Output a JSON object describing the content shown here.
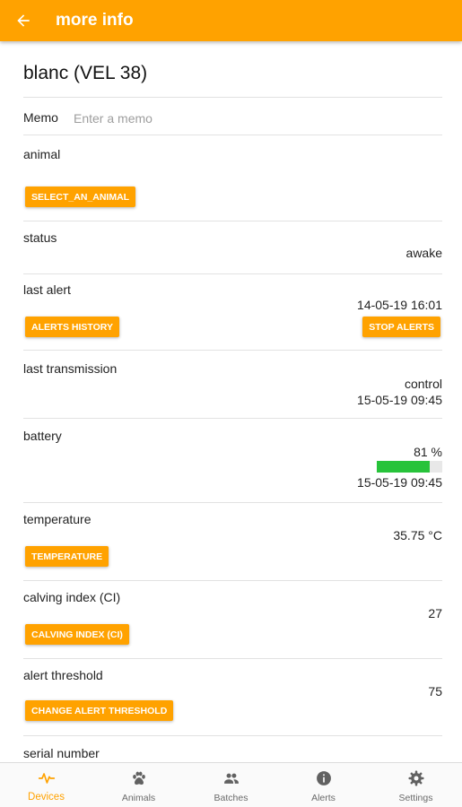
{
  "appbar": {
    "title": "more info",
    "back_icon": "arrow-left-icon"
  },
  "device": {
    "name": "blanc (VEL 38)"
  },
  "memo": {
    "label": "Memo",
    "value": "",
    "placeholder": "Enter a memo"
  },
  "animal": {
    "label": "animal",
    "button": "SELECT_AN_ANIMAL"
  },
  "status": {
    "label": "status",
    "value": "awake"
  },
  "last_alert": {
    "label": "last alert",
    "datetime": "14-05-19 16:01",
    "history_button": "ALERTS HISTORY",
    "stop_button": "STOP ALERTS"
  },
  "last_transmission": {
    "label": "last transmission",
    "type": "control",
    "datetime": "15-05-19 09:45"
  },
  "battery": {
    "label": "battery",
    "percent_text": "81 %",
    "level": 0.81,
    "datetime": "15-05-19 09:45"
  },
  "temperature": {
    "label": "temperature",
    "value": "35.75 °C",
    "button": "TEMPERATURE"
  },
  "calving_index": {
    "label": "calving index (CI)",
    "value": "27",
    "button": "CALVING INDEX (CI)"
  },
  "alert_threshold": {
    "label": "alert threshold",
    "value": "75",
    "button": "CHANGE ALERT THRESHOLD"
  },
  "serial_number": {
    "label": "serial number"
  },
  "colors": {
    "accent": "#ffa200",
    "battery": "#27c33a",
    "nav_inactive": "#616161"
  },
  "nav": {
    "devices": {
      "label": "Devices",
      "icon": "pulse-icon"
    },
    "animals": {
      "label": "Animals",
      "icon": "paw-icon"
    },
    "batches": {
      "label": "Batches",
      "icon": "group-icon"
    },
    "alerts": {
      "label": "Alerts",
      "icon": "info-icon"
    },
    "settings": {
      "label": "Settings",
      "icon": "gear-icon"
    }
  }
}
